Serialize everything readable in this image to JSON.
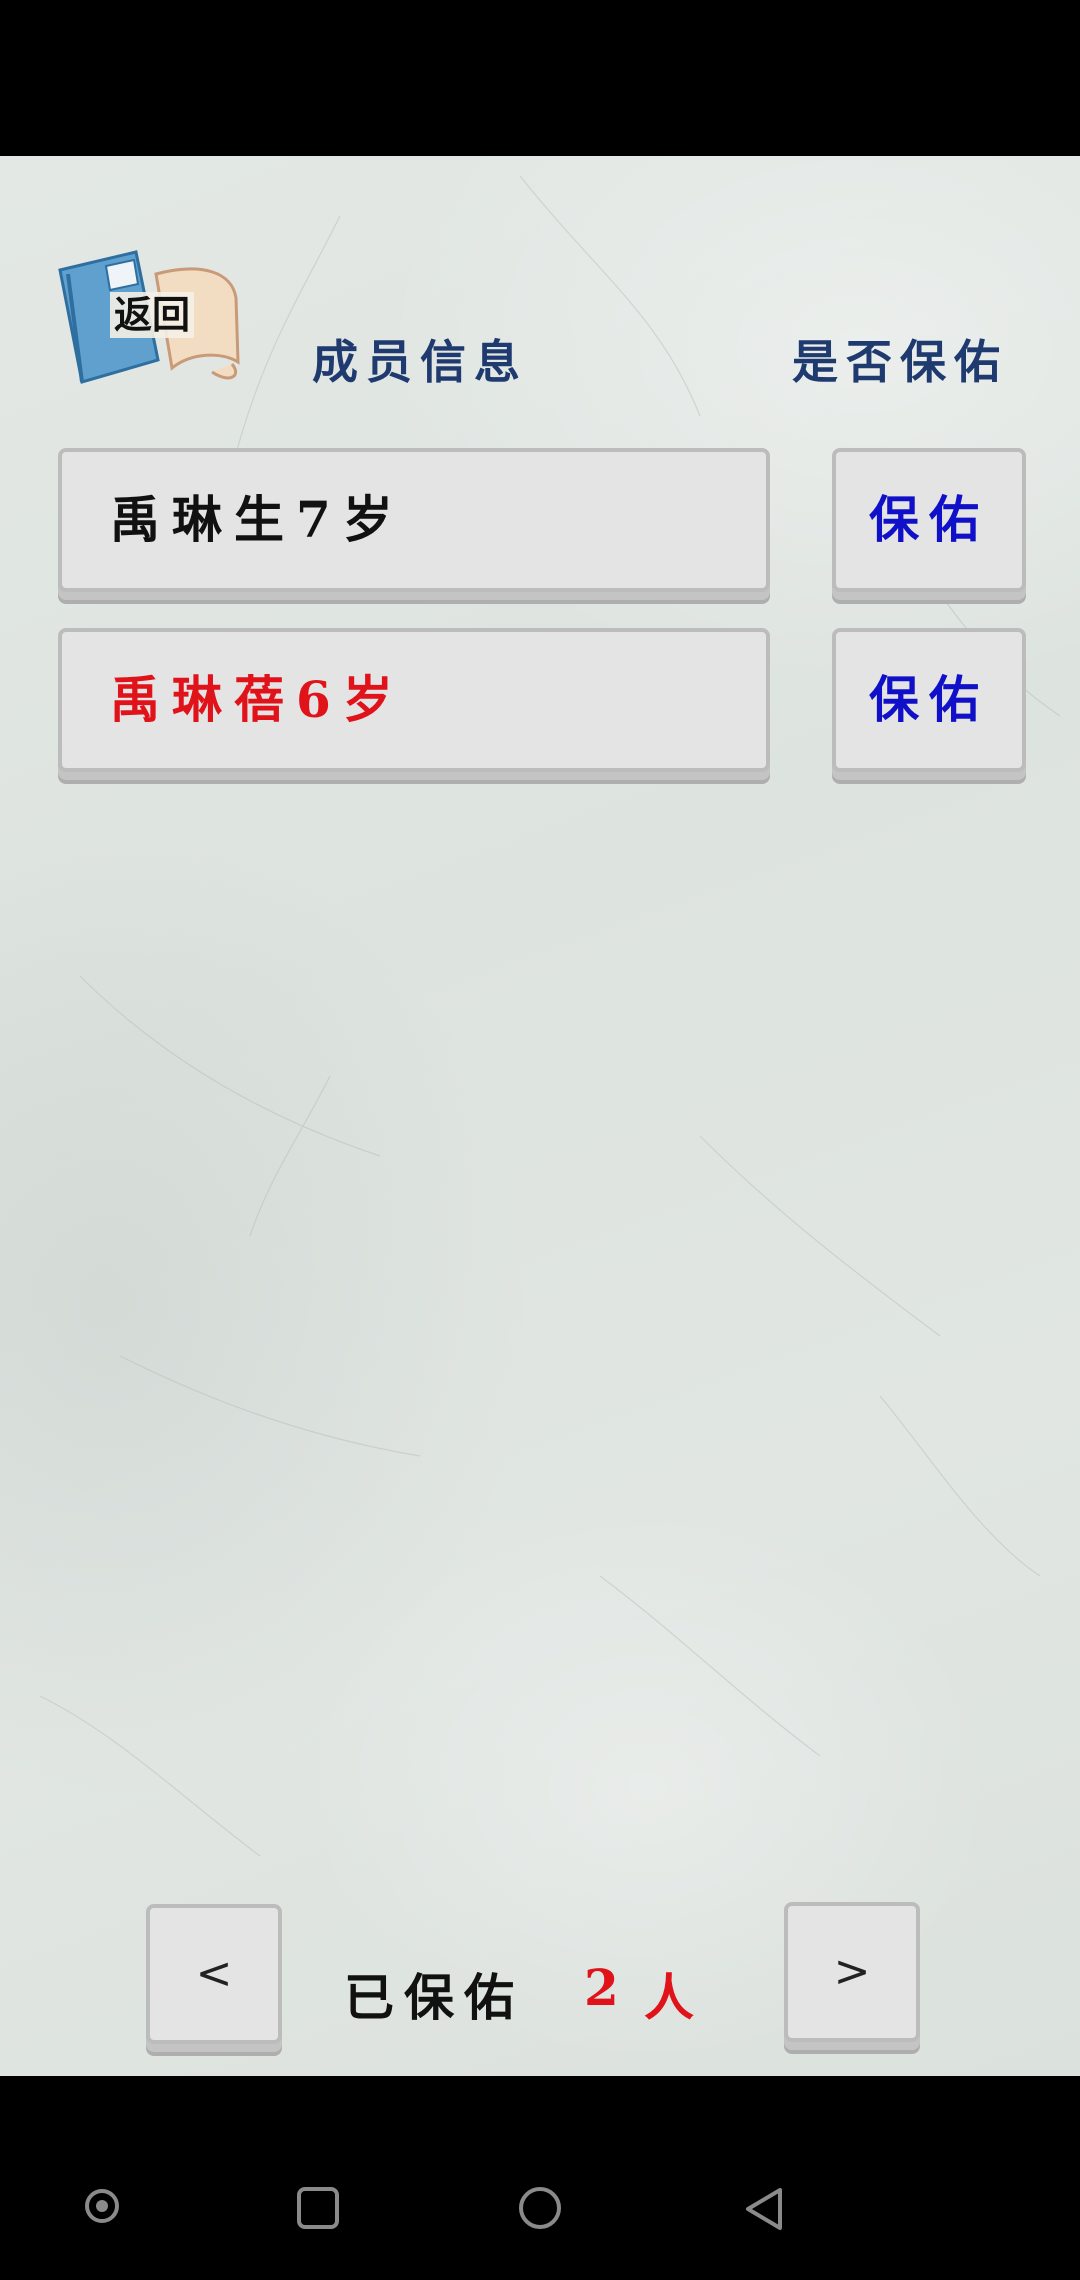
{
  "header": {
    "back_label": "返回",
    "member_info": "成员信息",
    "bless_status": "是否保佑"
  },
  "members": [
    {
      "label": "禹琳生7岁",
      "color": "#111111",
      "action": "保佑"
    },
    {
      "label": "禹琳蓓6岁",
      "color": "#e0121a",
      "action": "保佑"
    }
  ],
  "footer": {
    "prev": "<",
    "next": ">",
    "count_label": "已保佑",
    "count_value": "2",
    "count_unit": "人"
  },
  "system_nav": {
    "icons": [
      "dot-icon",
      "recents-icon",
      "home-icon",
      "back-icon"
    ]
  }
}
